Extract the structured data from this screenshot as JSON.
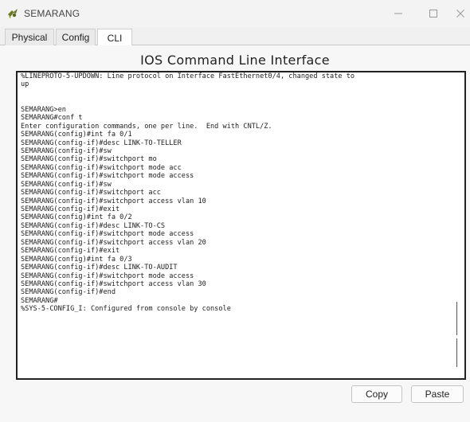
{
  "window": {
    "title": "SEMARANG",
    "app_icon": "packet-tracer-router-icon",
    "controls": {
      "minimize": "—",
      "maximize": "☐",
      "close": "✕"
    }
  },
  "tabs": [
    {
      "label": "Physical",
      "active": false
    },
    {
      "label": "Config",
      "active": false
    },
    {
      "label": "CLI",
      "active": true
    }
  ],
  "cli": {
    "heading": "IOS Command Line Interface",
    "lines": [
      "%LINEPROTO-5-UPDOWN: Line protocol on Interface FastEthernet0/4, changed state to",
      "up",
      "",
      "",
      "SEMARANG>en",
      "SEMARANG#conf t",
      "Enter configuration commands, one per line.  End with CNTL/Z.",
      "SEMARANG(config)#int fa 0/1",
      "SEMARANG(config-if)#desc LINK-TO-TELLER",
      "SEMARANG(config-if)#sw",
      "SEMARANG(config-if)#switchport mo",
      "SEMARANG(config-if)#switchport mode acc",
      "SEMARANG(config-if)#switchport mode access",
      "SEMARANG(config-if)#sw",
      "SEMARANG(config-if)#switchport acc",
      "SEMARANG(config-if)#switchport access vlan 10",
      "SEMARANG(config-if)#exit",
      "SEMARANG(config)#int fa 0/2",
      "SEMARANG(config-if)#desc LINK-TO-CS",
      "SEMARANG(config-if)#switchport mode access",
      "SEMARANG(config-if)#switchport access vlan 20",
      "SEMARANG(config-if)#exit",
      "SEMARANG(config)#int fa 0/3",
      "SEMARANG(config-if)#desc LINK-TO-AUDIT",
      "SEMARANG(config-if)#switchport mode access",
      "SEMARANG(config-if)#switchport access vlan 30",
      "SEMARANG(config-if)#end",
      "SEMARANG#",
      "%SYS-5-CONFIG_I: Configured from console by console"
    ]
  },
  "buttons": {
    "copy": "Copy",
    "paste": "Paste"
  }
}
